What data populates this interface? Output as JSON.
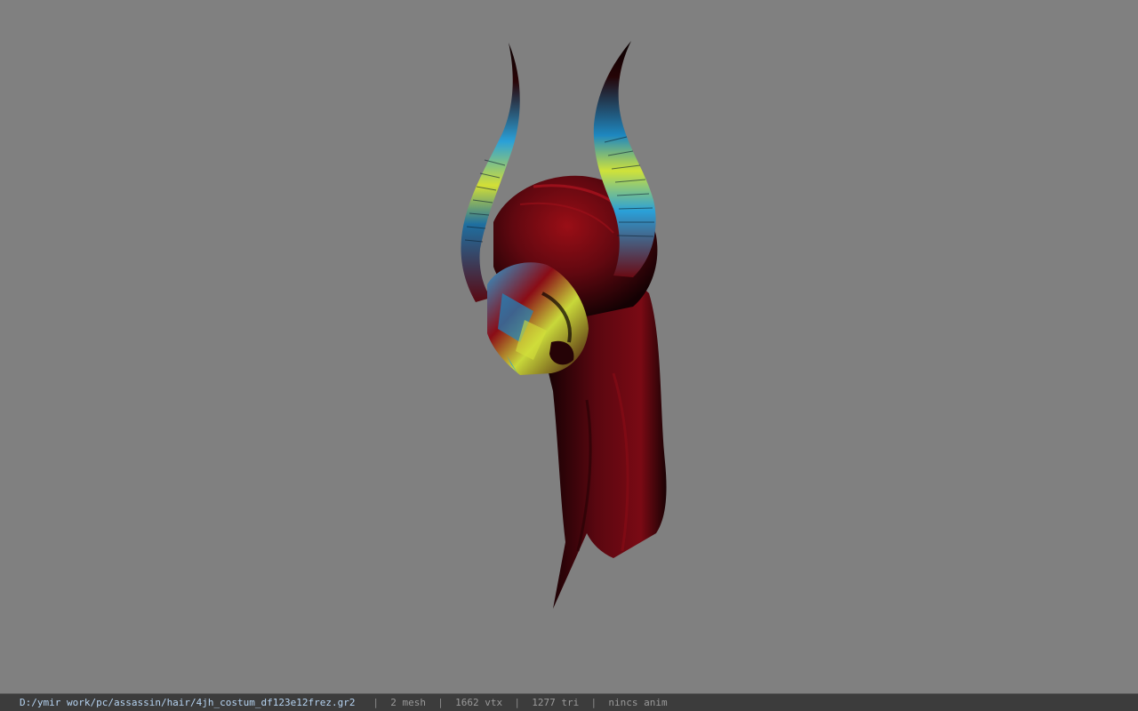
{
  "viewer": {
    "background_color": "#808080",
    "model": {
      "icon": "horned-demon-mask-hair-model",
      "colors": {
        "base": "#6e0a10",
        "dark": "#1a0204",
        "accent_blue": "#2aa0d8",
        "accent_yellow": "#d6e23a"
      }
    }
  },
  "status_bar": {
    "file_path": "D:/ymir work/pc/assassin/hair/4jh_costum_df123e12frez.gr2",
    "separator": "|",
    "mesh_count": "2 mesh",
    "vertex_count": "1662 vtx",
    "triangle_count": "1277 tri",
    "animation": "nincs anim"
  }
}
